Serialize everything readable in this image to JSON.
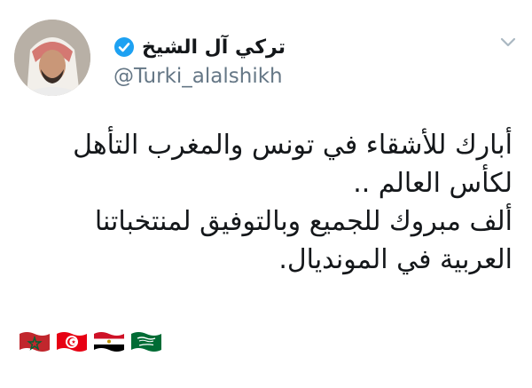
{
  "tweet": {
    "display_name": "تركي آل الشيخ",
    "handle": "@Turki_alalshikh",
    "lines": [
      "أبارك للأشقاء في تونس والمغرب التأهل",
      "لكأس العالم ..",
      "ألف مبروك للجميع وبالتوفيق لمنتخباتنا",
      "العربية في المونديال."
    ],
    "flags": [
      "morocco-flag-icon",
      "tunisia-flag-icon",
      "egypt-flag-icon",
      "saudi-flag-icon"
    ]
  },
  "colors": {
    "verified": "#1da1f2",
    "handle": "#657786",
    "text": "#14171a",
    "caret": "#aab8c2"
  },
  "icons": {
    "verified": "verified-badge-icon",
    "menu": "chevron-down-icon"
  }
}
